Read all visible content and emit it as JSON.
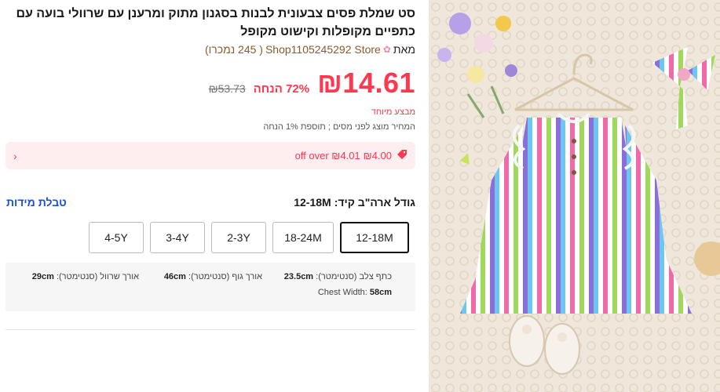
{
  "product": {
    "title": "סט שמלת פסים צבעונית לבנות בסגנון מתוק ומרענן עם שרוולי בועה עם כתפיים מקופלות וקישוט מקופל",
    "store_prefix": "מאת",
    "store_name": "Shop1105245292 Store",
    "store_sold": "( 245 נמכרו)"
  },
  "price": {
    "current": "₪14.61",
    "discount": "72% הנחה",
    "original": "₪53.73",
    "special_label": "מבצע מיוחד",
    "tax_note": "המחיר מוצג לפני מסים ; תוספת 1% הנחה"
  },
  "coupon": {
    "amount": "₪4.00",
    "threshold": "off over ₪4.01",
    "icon": "tag-icon",
    "chevron": "chevron-icon"
  },
  "sizes": {
    "label": "גודל ארה\"ב קיד:",
    "selected": "12-18M",
    "chart_link": "טבלת מידות",
    "options": [
      "12-18M",
      "18-24M",
      "2-3Y",
      "3-4Y",
      "4-5Y"
    ]
  },
  "measurements": {
    "shoulder_label": "כתף צלב (סנטימטר):",
    "shoulder_value": "23.5cm",
    "body_label": "אורך גוף (סנטימטר):",
    "body_value": "46cm",
    "sleeve_label": "אורך שרוול (סנטימטר):",
    "sleeve_value": "29cm",
    "chest_label": "Chest Width:",
    "chest_value": "58cm"
  },
  "colors": {
    "accent": "#fd384f",
    "link": "#1a4fd6",
    "coupon_bg": "#ffeef0"
  }
}
